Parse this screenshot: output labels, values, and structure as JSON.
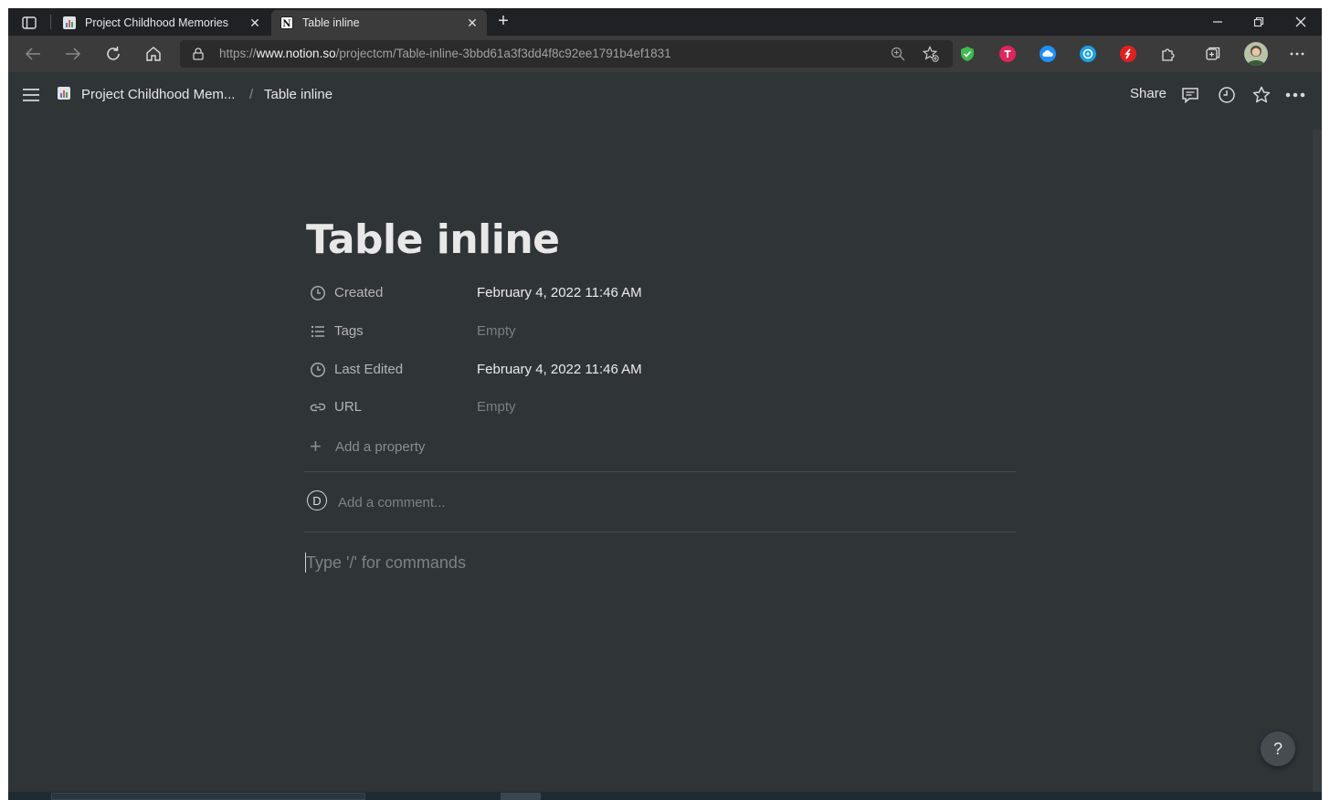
{
  "browser": {
    "tabs": [
      {
        "title": "Project Childhood Memories",
        "active": false,
        "favicon": "notion-page-chart-icon"
      },
      {
        "title": "Table inline",
        "active": true,
        "favicon": "notion-logo-icon"
      }
    ],
    "url_prefix": "https://",
    "url_domain": "www.notion.so",
    "url_path": "/projectcm/Table-inline-3bbd61a3f3dd4f8c92ee1791b4ef1831",
    "extensions": [
      {
        "name": "shield-extension-icon",
        "color": "#3fb950"
      },
      {
        "name": "pink-extension-icon",
        "color": "#e0245e"
      },
      {
        "name": "cloud-extension-icon",
        "color": "#1e90ff"
      },
      {
        "name": "blue-circle-extension-icon",
        "color": "#1ba1e2"
      },
      {
        "name": "red-extension-icon",
        "color": "#e02020"
      }
    ]
  },
  "notion": {
    "breadcrumb": {
      "parent": "Project Childhood Mem...",
      "separator": "/",
      "current": "Table inline"
    },
    "share_label": "Share",
    "page": {
      "title": "Table inline",
      "properties": [
        {
          "icon": "clock-icon",
          "name": "Created",
          "value": "February 4, 2022 11:46 AM",
          "empty": false
        },
        {
          "icon": "list-icon",
          "name": "Tags",
          "value": "Empty",
          "empty": true
        },
        {
          "icon": "clock-icon",
          "name": "Last Edited",
          "value": "February 4, 2022 11:46 AM",
          "empty": false
        },
        {
          "icon": "link-icon",
          "name": "URL",
          "value": "Empty",
          "empty": true
        }
      ],
      "add_property_label": "Add a property",
      "comment_avatar_initial": "D",
      "comment_placeholder": "Add a comment...",
      "editor_placeholder": "Type '/' for commands"
    },
    "help_label": "?"
  }
}
